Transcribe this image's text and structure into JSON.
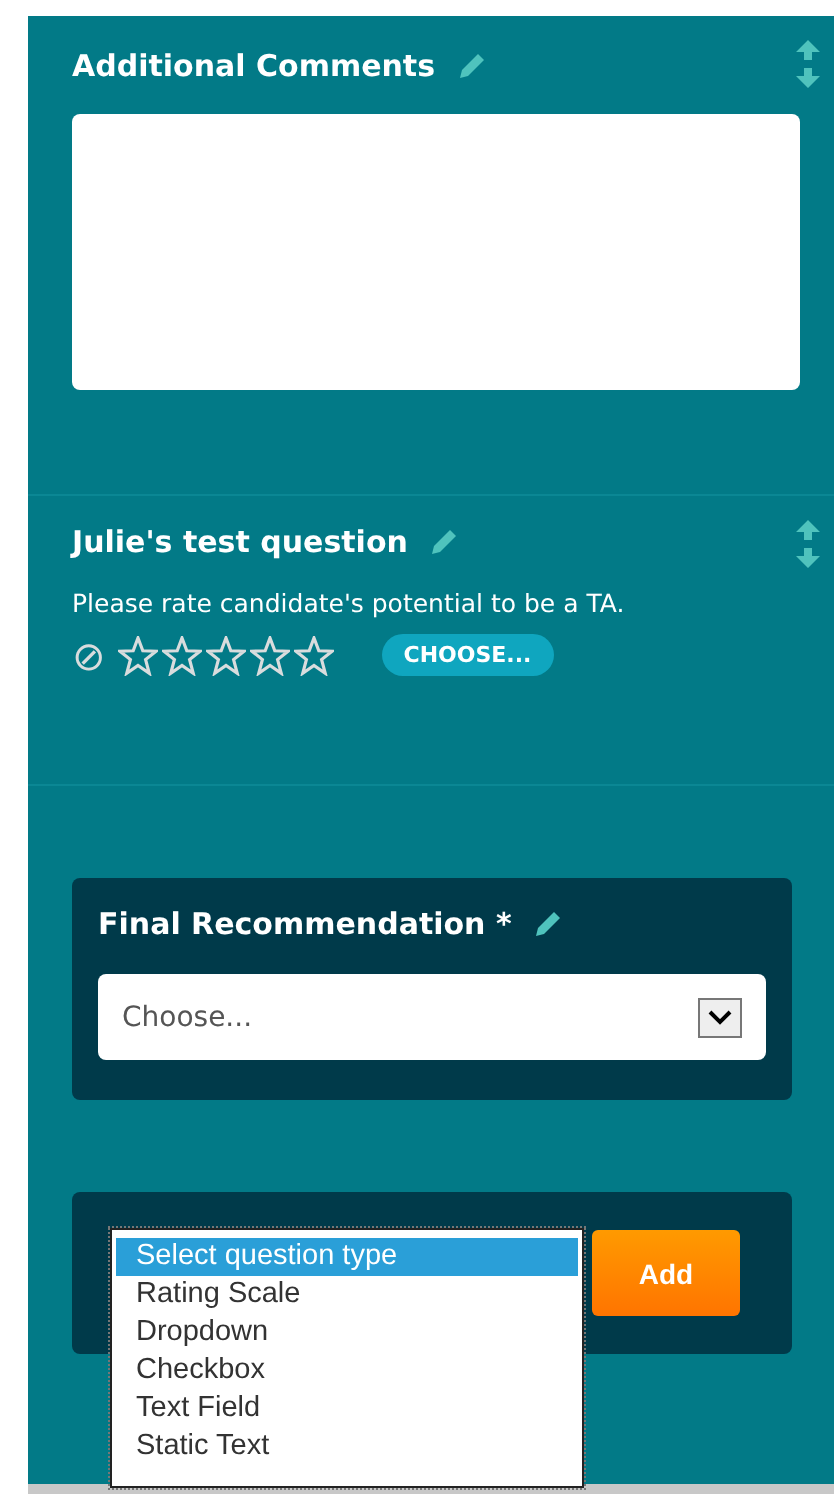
{
  "comments_section": {
    "title": "Additional Comments"
  },
  "question_section": {
    "title": "Julie's test question",
    "prompt": "Please rate candidate's potential to be a TA.",
    "clear_icon": "⊘",
    "stars": 0,
    "choose_button": "CHOOSE..."
  },
  "final_recommendation": {
    "title": "Final Recommendation *",
    "select": {
      "placeholder": "Choose..."
    }
  },
  "add_question": {
    "options": [
      {
        "label": "Select question type",
        "selected": true
      },
      {
        "label": "Rating Scale",
        "selected": false
      },
      {
        "label": "Dropdown",
        "selected": false
      },
      {
        "label": "Checkbox",
        "selected": false
      },
      {
        "label": "Text Field",
        "selected": false
      },
      {
        "label": "Static Text",
        "selected": false
      }
    ],
    "add_button": "Add"
  }
}
